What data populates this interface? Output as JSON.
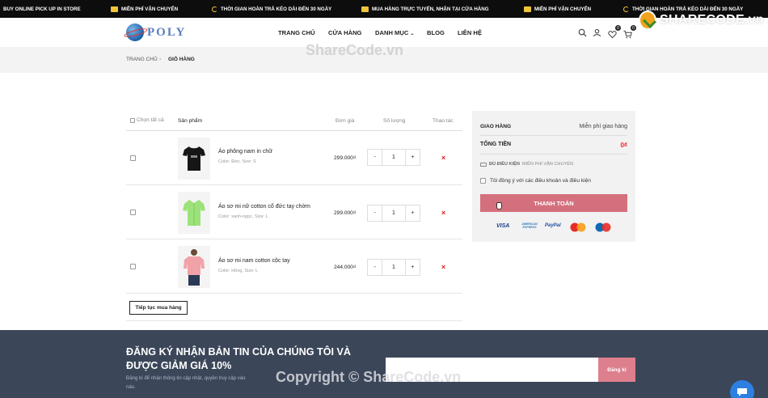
{
  "topbar": {
    "items": [
      {
        "icon": "store-icon",
        "text": "BUY ONLINE PICK UP IN STORE"
      },
      {
        "icon": "truck-icon",
        "text": "MIỄN PHÍ VẬN CHUYỂN"
      },
      {
        "icon": "return-icon",
        "text": "THỜI GIAN HOÀN TRẢ KÉO DÀI ĐẾN 30 NGÀY"
      },
      {
        "icon": "store-icon",
        "text": "MUA HÀNG TRỰC TUYẾN, NHẬN TẠI CỬA HÀNG"
      },
      {
        "icon": "truck-icon",
        "text": "MIỄN PHÍ VẬN CHUYỂN"
      },
      {
        "icon": "return-icon",
        "text": "THỜI GIAN HOÀN TRẢ KÉO DÀI ĐẾN 30 NGÀY"
      }
    ]
  },
  "header": {
    "logo_text": "POLY",
    "nav": [
      "TRANG CHỦ",
      "CỬA HÀNG",
      "DANH MỤC",
      "BLOG",
      "LIÊN HỆ"
    ],
    "wishlist_count": "0",
    "cart_count": "0"
  },
  "breadcrumb": {
    "home": "TRANG CHỦ",
    "separator": "›",
    "current": "GIỎ HÀNG"
  },
  "cart": {
    "headers": {
      "select_all": "Chọn tất cả",
      "product": "Sản phẩm",
      "unit_price": "Đơn giá",
      "quantity": "Số lượng",
      "actions": "Thao tác"
    },
    "items": [
      {
        "name": "Áo phông nam in chữ",
        "meta": "Color: Đen, Size: S",
        "price": "299.000₫",
        "qty": "1",
        "minus": "-",
        "plus": "+",
        "delete": "×"
      },
      {
        "name": "Áo sơ mi nữ cotton cổ đức tay chờm",
        "meta": "Color: xanh-ngọc, Size: L",
        "price": "299.000₫",
        "qty": "1",
        "minus": "-",
        "plus": "+",
        "delete": "×"
      },
      {
        "name": "Áo sơ mi nam cotton cộc tay",
        "meta": "Color: Hồng, Size: L",
        "price": "244.000₫",
        "qty": "1",
        "minus": "-",
        "plus": "+",
        "delete": "×"
      }
    ],
    "continue_label": "Tiếp tục mua hàng"
  },
  "summary": {
    "shipping_label": "GIAO HÀNG",
    "shipping_value": "Miễn phí giao hàng",
    "total_label": "TỔNG TIỀN",
    "total_value": "0₫",
    "free_ship_prefix": "ĐỦ ĐIỀU KIỆN",
    "free_ship_note": "MIỄN PHÍ VẬN CHUYỂN",
    "terms_label": "Tôi đồng ý với các điều khoản và điều kiện",
    "pay_label": "THANH TOÁN",
    "cards": [
      "VISA",
      "AMERICAN EXPRESS",
      "PayPal",
      "mastercard",
      "Maestro"
    ]
  },
  "newsletter": {
    "title_line1": "ĐĂNG KÝ NHẬN BẢN TIN CỦA CHÚNG TÔI VÀ",
    "title_line2": "ĐƯỢC GIẢM GIÁ 10%",
    "note_line1": "Đăng kí để nhận thông tin cập nhật, quyền truy cập vào",
    "note_line2": "nào.",
    "input_placeholder": "",
    "button_label": "Đăng kí"
  },
  "watermarks": {
    "logo": "SHARECODE.vn",
    "center": "ShareCode.vn",
    "footer": "Copyright © ShareCode.vn"
  },
  "colors": {
    "accent": "#d4707d",
    "footer_bg": "#3b4659",
    "delete": "#dd2222"
  }
}
